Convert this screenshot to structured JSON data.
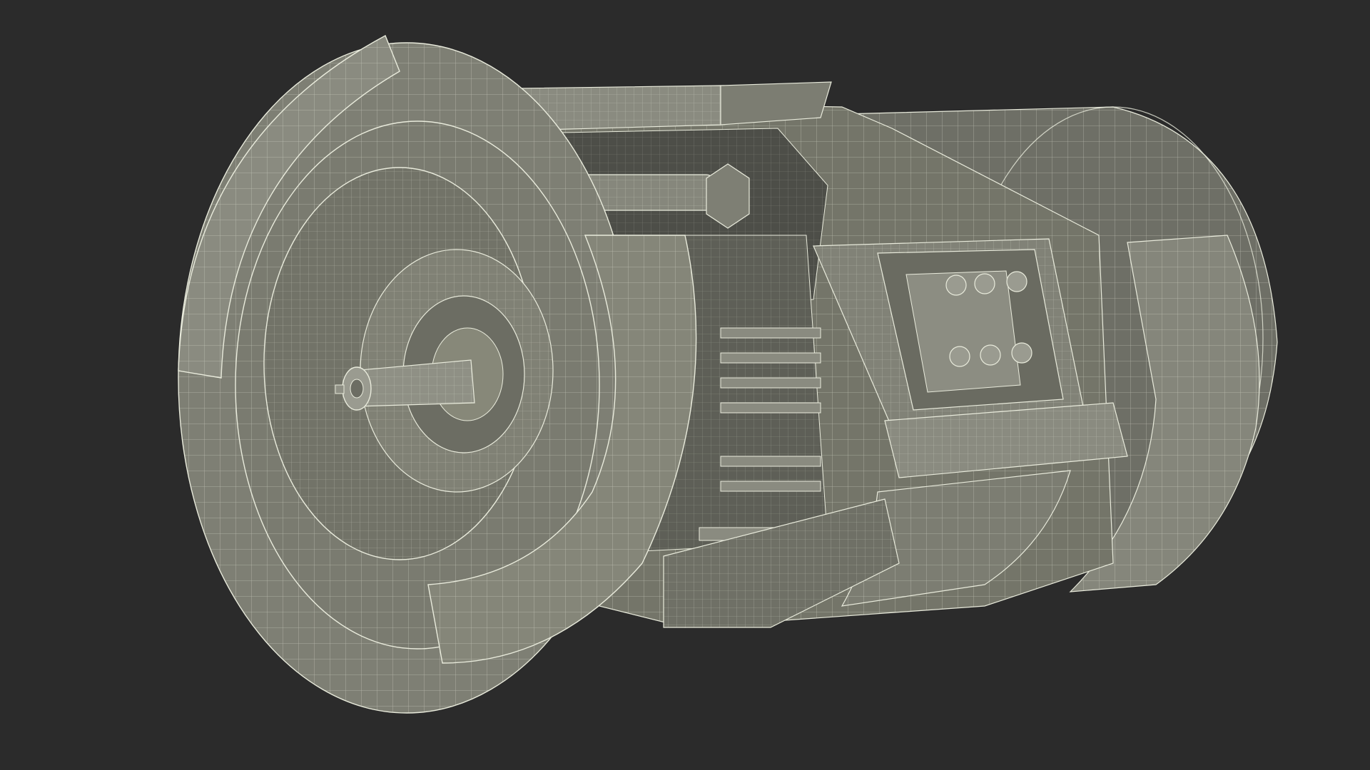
{
  "scene": {
    "subject": "electric-motor-cutaway-wireframe",
    "colors": {
      "background": "#2b2b2b",
      "surface": "#7e7f74",
      "surface_light": "#8f9085",
      "surface_dark": "#5f6058",
      "shadow": "#44453f",
      "wire": "#e9ebdc"
    }
  }
}
